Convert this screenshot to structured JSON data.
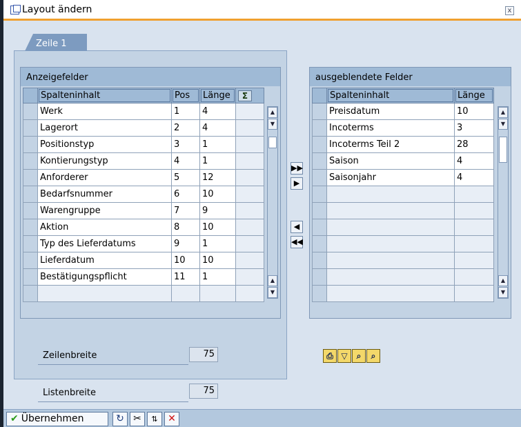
{
  "window": {
    "title": "Layout ändern",
    "close_label": "x"
  },
  "tabs": [
    {
      "label": "Zeile 1"
    }
  ],
  "left_table": {
    "group_title": "Anzeigefelder",
    "headers": {
      "content": "Spalteninhalt",
      "pos": "Pos",
      "length": "Länge",
      "sum_icon": "Σ"
    },
    "rows": [
      {
        "content": "Werk",
        "pos": "1",
        "length": "4"
      },
      {
        "content": "Lagerort",
        "pos": "2",
        "length": "4"
      },
      {
        "content": "Positionstyp",
        "pos": "3",
        "length": "1"
      },
      {
        "content": "Kontierungstyp",
        "pos": "4",
        "length": "1"
      },
      {
        "content": "Anforderer",
        "pos": "5",
        "length": "12"
      },
      {
        "content": "Bedarfsnummer",
        "pos": "6",
        "length": "10"
      },
      {
        "content": "Warengruppe",
        "pos": "7",
        "length": "9"
      },
      {
        "content": "Aktion",
        "pos": "8",
        "length": "10"
      },
      {
        "content": "Typ des Lieferdatums",
        "pos": "9",
        "length": "1"
      },
      {
        "content": "Lieferdatum",
        "pos": "10",
        "length": "10"
      },
      {
        "content": "Bestätigungspflicht",
        "pos": "11",
        "length": "1"
      }
    ]
  },
  "right_table": {
    "group_title": "ausgeblendete Felder",
    "headers": {
      "content": "Spalteninhalt",
      "length": "Länge"
    },
    "rows": [
      {
        "content": "Preisdatum",
        "length": "10"
      },
      {
        "content": "Incoterms",
        "length": "3"
      },
      {
        "content": "Incoterms Teil 2",
        "length": "28"
      },
      {
        "content": "Saison",
        "length": "4"
      },
      {
        "content": "Saisonjahr",
        "length": "4"
      }
    ]
  },
  "widths": {
    "line_label": "Zeilenbreite",
    "line_value": "75",
    "list_label": "Listenbreite",
    "list_value": "75"
  },
  "footer": {
    "apply_label": "Übernehmen"
  },
  "colors": {
    "panel": "#c3d3e4",
    "header": "#9fbad6",
    "tab": "#7d9bc0",
    "accent": "#f0a030"
  }
}
